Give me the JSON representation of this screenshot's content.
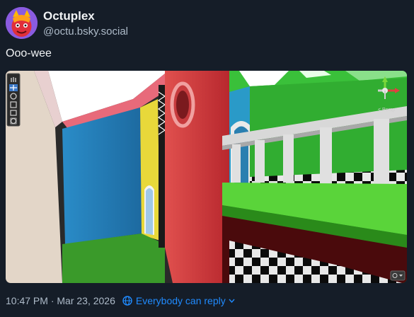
{
  "author": {
    "display_name": "Octuplex",
    "handle": "@octu.bsky.social",
    "avatar_icon": "red-devil-avatar-icon"
  },
  "post": {
    "text": "Ooo-wee",
    "media": {
      "description": "",
      "toolbar_icons": [
        "hand-tool-icon",
        "move-tool-icon",
        "rotate-tool-icon",
        "scale-tool-icon",
        "rect-tool-icon",
        "transform-tool-icon"
      ],
      "gizmo_label": "< Persp"
    }
  },
  "meta": {
    "timestamp": "10:47 PM · Mar 23, 2026",
    "reply_setting": "Everybody can reply"
  },
  "colors": {
    "background": "#151d28",
    "link": "#208bfe",
    "muted": "#aebbc9"
  }
}
